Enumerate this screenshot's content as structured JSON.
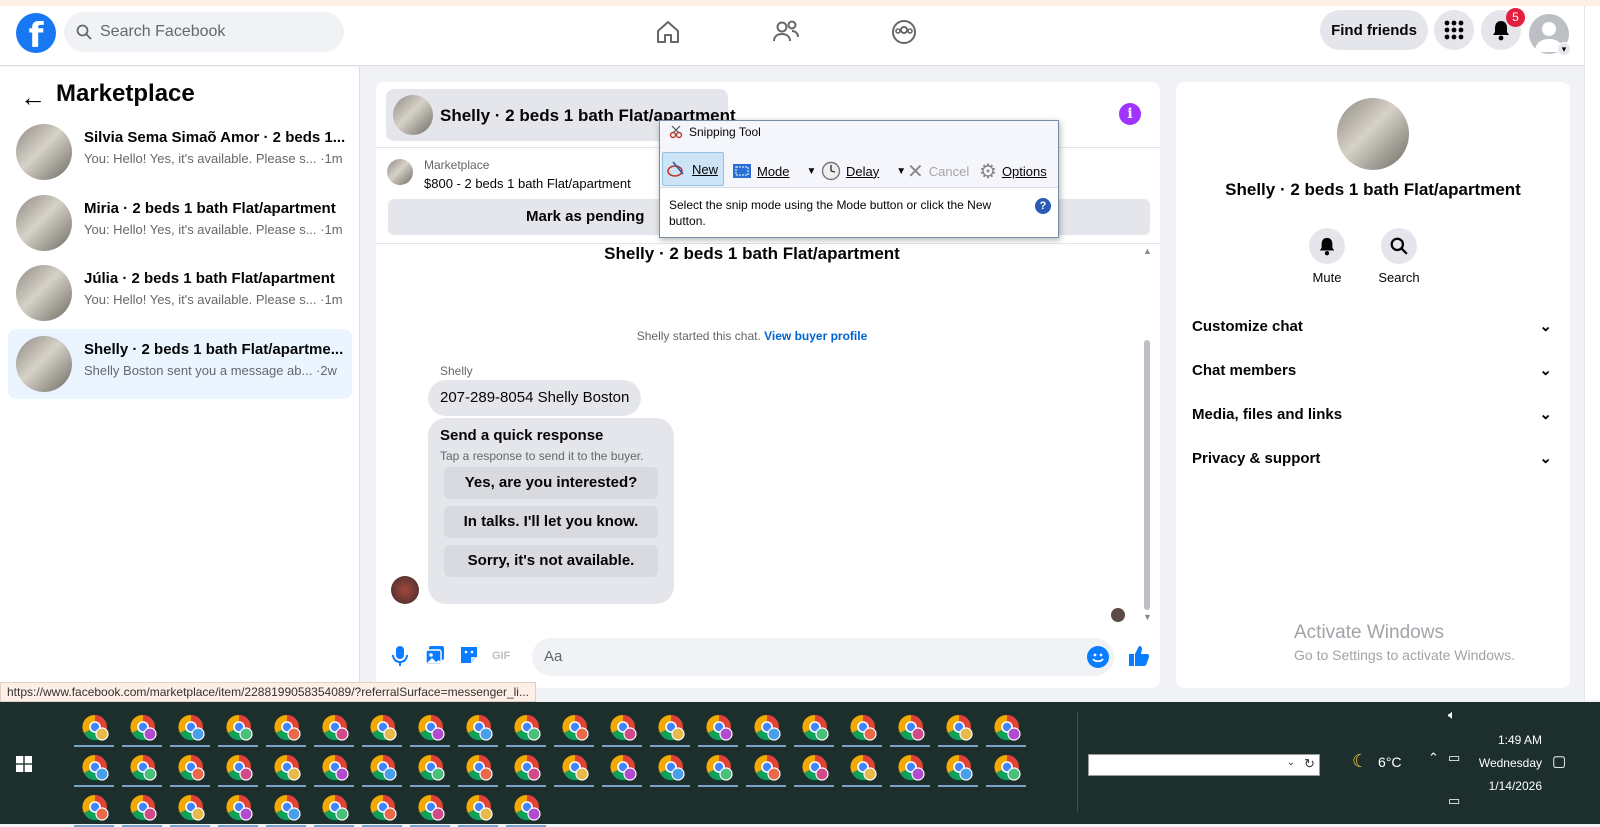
{
  "header": {
    "search_placeholder": "Search Facebook",
    "find_friends": "Find friends",
    "notification_count": "5"
  },
  "left_panel": {
    "title": "Marketplace",
    "conversations": [
      {
        "name": "Silvia Sema Simaõ Amor · 2 beds 1...",
        "snippet": "You: Hello! Yes, it's available. Please s... ·1m"
      },
      {
        "name": "Miria · 2 beds 1 bath Flat/apartment",
        "snippet": "You: Hello! Yes, it's available. Please s... ·1m"
      },
      {
        "name": "Júlia · 2 beds 1 bath Flat/apartment",
        "snippet": "You: Hello! Yes, it's available. Please s... ·1m"
      },
      {
        "name": "Shelly · 2 beds 1 bath Flat/apartme...",
        "snippet": "Shelly Boston sent you a message ab... ·2w",
        "active": true
      }
    ]
  },
  "chat": {
    "header_title": "Shelly · 2 beds 1 bath Flat/apartment",
    "listing_source": "Marketplace",
    "listing_price_title": "$800 - 2 beds 1 bath Flat/apartment",
    "mark_pending": "Mark as pending",
    "conversation_title": "Shelly · 2 beds 1 bath Flat/apartment",
    "started_text": "Shelly started this chat.",
    "view_buyer_profile": "View buyer profile",
    "sender_name": "Shelly",
    "message": "207-289-8054  Shelly Boston",
    "quick_response_title": "Send a quick response",
    "quick_response_sub": "Tap a response to send it to the buyer.",
    "quick_responses": [
      "Yes, are you interested?",
      "In talks. I'll let you know.",
      "Sorry, it's not available."
    ],
    "composer_placeholder": "Aa",
    "composer_gif": "GIF"
  },
  "snipping_tool": {
    "title": "Snipping Tool",
    "new": "New",
    "mode": "Mode",
    "delay": "Delay",
    "cancel": "Cancel",
    "options": "Options",
    "message": "Select the snip mode using the Mode button or click the New button.",
    "help": "?"
  },
  "right_panel": {
    "title": "Shelly · 2 beds 1 bath Flat/apartment",
    "mute": "Mute",
    "search": "Search",
    "sections": [
      "Customize chat",
      "Chat members",
      "Media, files and links",
      "Privacy & support"
    ],
    "watermark_title": "Activate Windows",
    "watermark_sub": "Go to Settings to activate Windows."
  },
  "status_url": "https://www.facebook.com/marketplace/item/2288199058354089/?referralSurface=messenger_li...",
  "taskbar": {
    "weather": "6°C",
    "time": "1:49 AM",
    "day": "Wednesday",
    "date": "1/14/2026"
  },
  "colors": {
    "facebook_blue": "#1877f2",
    "messenger_blue": "#0a7cff",
    "taskbar_bg": "#1d2f2c",
    "badge_red": "#e41e3f"
  }
}
